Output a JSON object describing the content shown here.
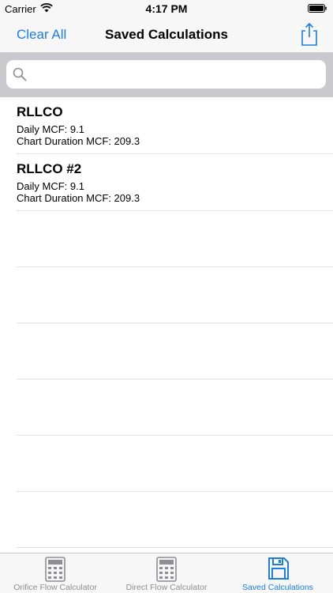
{
  "status_bar": {
    "carrier": "Carrier",
    "time": "4:17 PM"
  },
  "nav": {
    "left_button": "Clear All",
    "title": "Saved Calculations",
    "right_icon": "share-icon"
  },
  "search": {
    "placeholder": "",
    "value": ""
  },
  "saved_items": [
    {
      "title": "RLLCO",
      "daily": "Daily MCF: 9.1",
      "chart": "Chart Duration MCF: 209.3"
    },
    {
      "title": "RLLCO #2",
      "daily": "Daily MCF: 9.1",
      "chart": "Chart Duration MCF: 209.3"
    }
  ],
  "tabs": [
    {
      "label": "Orifice Flow Calculator",
      "icon": "calculator-icon",
      "active": false
    },
    {
      "label": "Direct Flow Calculator",
      "icon": "calculator-icon",
      "active": false
    },
    {
      "label": "Saved Calculations",
      "icon": "floppy-disk-icon",
      "active": true
    }
  ],
  "colors": {
    "accent": "#1b7ee0",
    "inactive": "#8e8e93",
    "search_bg": "#c9c9ce"
  }
}
